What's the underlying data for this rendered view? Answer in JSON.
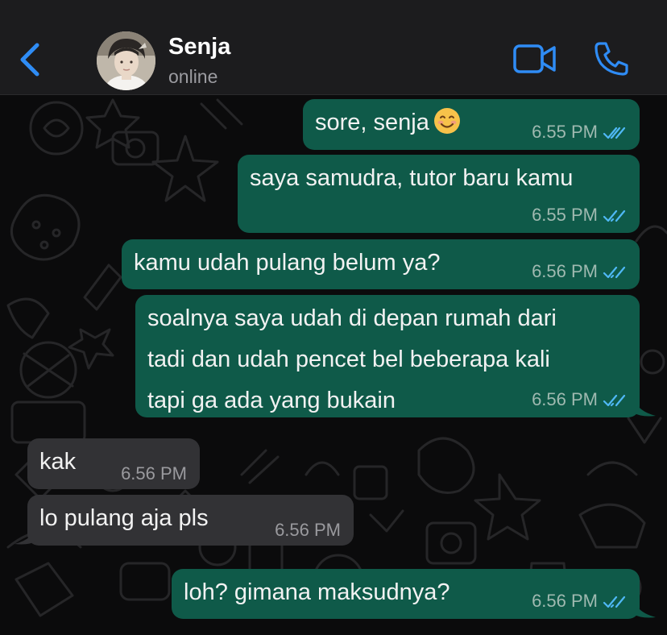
{
  "header": {
    "contact_name": "Senja",
    "status": "online",
    "back_icon": "chevron-left-icon",
    "video_icon": "video-camera-icon",
    "call_icon": "phone-icon"
  },
  "colors": {
    "header_bg": "#1c1c1e",
    "outgoing_bubble": "#0f5a49",
    "incoming_bubble": "#323235",
    "accent": "#2f8cf5",
    "read_ticks": "#4fb8f5"
  },
  "messages": [
    {
      "direction": "outgoing",
      "text": "sore, senja",
      "emoji": "smiling-face-emoji",
      "time": "6.55 PM",
      "status": "read"
    },
    {
      "direction": "outgoing",
      "text": "saya samudra, tutor baru kamu",
      "time": "6.55 PM",
      "status": "read"
    },
    {
      "direction": "outgoing",
      "text": "kamu udah pulang belum ya?",
      "time": "6.56 PM",
      "status": "read"
    },
    {
      "direction": "outgoing",
      "lines": [
        "soalnya saya udah di depan rumah dari",
        "tadi dan udah pencet bel beberapa kali",
        "tapi ga ada yang bukain"
      ],
      "time": "6.56 PM",
      "status": "read"
    },
    {
      "direction": "incoming",
      "text": "kak",
      "time": "6.56 PM"
    },
    {
      "direction": "incoming",
      "text": "lo pulang aja pls",
      "time": "6.56 PM"
    },
    {
      "direction": "outgoing",
      "text": "loh? gimana maksudnya?",
      "time": "6.56 PM",
      "status": "read"
    }
  ]
}
